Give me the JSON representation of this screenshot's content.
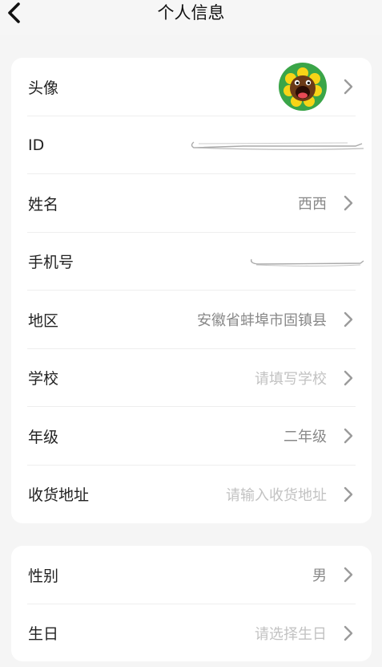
{
  "header": {
    "back_icon": "chevron-left-icon",
    "title": "个人信息"
  },
  "card1": {
    "avatar": {
      "label": "头像",
      "icon": "sunflower-avatar-icon"
    },
    "id": {
      "label": "ID",
      "value_redacted": true
    },
    "name": {
      "label": "姓名",
      "value": "西西"
    },
    "phone": {
      "label": "手机号",
      "value_redacted": true
    },
    "region": {
      "label": "地区",
      "value": "安徽省蚌埠市固镇县"
    },
    "school": {
      "label": "学校",
      "placeholder": "请填写学校"
    },
    "grade": {
      "label": "年级",
      "value": "二年级"
    },
    "address": {
      "label": "收货地址",
      "placeholder": "请输入收货地址"
    }
  },
  "card2": {
    "gender": {
      "label": "性别",
      "value": "男"
    },
    "birthday": {
      "label": "生日",
      "placeholder": "请选择生日"
    }
  },
  "colors": {
    "background": "#f5f5f5",
    "card": "#ffffff",
    "label": "#222222",
    "value": "#888888",
    "placeholder": "#c2c2c2",
    "chevron": "#9b9b9b"
  }
}
